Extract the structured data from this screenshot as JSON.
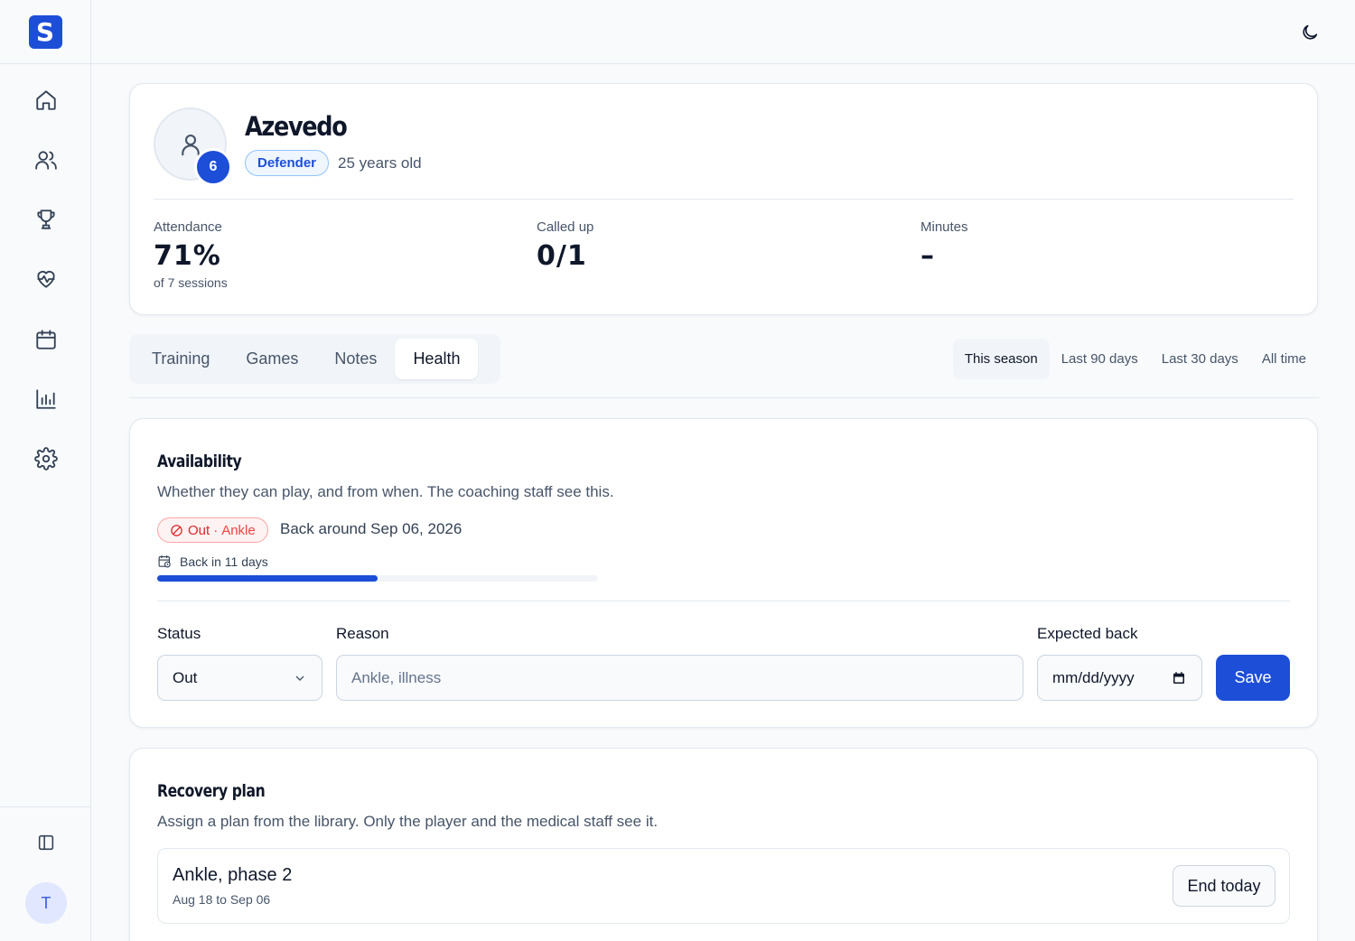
{
  "app": {
    "logo_letter": "S",
    "accent": "#1d4ed8"
  },
  "sidebar": {
    "items": [
      {
        "name": "home",
        "icon": "home-icon"
      },
      {
        "name": "players",
        "icon": "users-icon"
      },
      {
        "name": "competitions",
        "icon": "trophy-icon"
      },
      {
        "name": "health",
        "icon": "heart-pulse-icon"
      },
      {
        "name": "calendar",
        "icon": "calendar-icon"
      },
      {
        "name": "stats",
        "icon": "bar-chart-icon"
      },
      {
        "name": "settings",
        "icon": "gear-icon"
      }
    ],
    "collapse_icon": "panel-left-icon",
    "user_initial": "T"
  },
  "topbar": {
    "theme_icon": "moon-icon"
  },
  "player": {
    "name": "Azevedo",
    "number": "6",
    "position": "Defender",
    "age": "25 years old"
  },
  "stats": [
    {
      "label": "Attendance",
      "value": "71%",
      "sub": "of 7 sessions"
    },
    {
      "label": "Called up",
      "value": "0/1",
      "sub": ""
    },
    {
      "label": "Minutes",
      "value": "–",
      "sub": ""
    }
  ],
  "tabs": [
    "Training",
    "Games",
    "Notes",
    "Health"
  ],
  "active_tab": "Health",
  "ranges": [
    "This season",
    "Last 90 days",
    "Last 30 days",
    "All time"
  ],
  "active_range": "This season",
  "availability": {
    "title": "Availability",
    "description": "Whether they can play, and from when. The coaching staff see this.",
    "status": "Out",
    "separator": "·",
    "reason": "Ankle",
    "back_around": "Back around Sep 06, 2026",
    "back_in": "Back in 11 days",
    "progress_fraction": 0.5,
    "form": {
      "status_label": "Status",
      "status_value": "Out",
      "reason_label": "Reason",
      "reason_placeholder": "Ankle, illness",
      "expected_label": "Expected back",
      "expected_placeholder": "mm/dd/yyyy",
      "save_label": "Save"
    }
  },
  "recovery": {
    "title": "Recovery plan",
    "description": "Assign a plan from the library. Only the player and the medical staff see it.",
    "plan_name": "Ankle, phase 2",
    "plan_dates": "Aug 18 to Sep 06",
    "end_label": "End today"
  }
}
